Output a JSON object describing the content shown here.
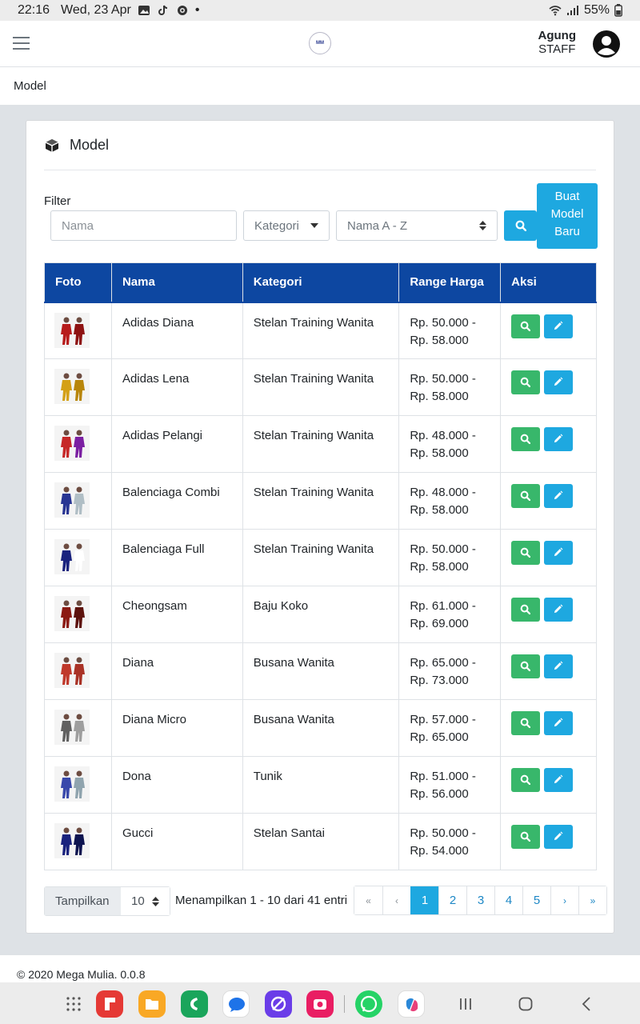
{
  "status_bar": {
    "time": "22:16",
    "date": "Wed, 23 Apr",
    "dot": "•",
    "battery": "55%"
  },
  "header": {
    "logo_text": "MM",
    "user_name": "Agung",
    "user_role": "STAFF"
  },
  "breadcrumb": "Model",
  "card": {
    "title": "Model"
  },
  "filter": {
    "label": "Filter",
    "nama_placeholder": "Nama",
    "kategori_value": "Kategori",
    "sort_value": "Nama A - Z",
    "buat_label": [
      "Buat",
      "Model",
      "Baru"
    ]
  },
  "table": {
    "columns": [
      "Foto",
      "Nama",
      "Kategori",
      "Range Harga",
      "Aksi"
    ],
    "rows": [
      {
        "nama": "Adidas Diana",
        "kategori": "Stelan Training Wanita",
        "harga_min": "Rp. 50.000 -",
        "harga_max": "Rp. 58.000"
      },
      {
        "nama": "Adidas Lena",
        "kategori": "Stelan Training Wanita",
        "harga_min": "Rp. 50.000 -",
        "harga_max": "Rp. 58.000"
      },
      {
        "nama": "Adidas Pelangi",
        "kategori": "Stelan Training Wanita",
        "harga_min": "Rp. 48.000 -",
        "harga_max": "Rp. 58.000"
      },
      {
        "nama": "Balenciaga Combi",
        "kategori": "Stelan Training Wanita",
        "harga_min": "Rp. 48.000 -",
        "harga_max": "Rp. 58.000"
      },
      {
        "nama": "Balenciaga Full",
        "kategori": "Stelan Training Wanita",
        "harga_min": "Rp. 50.000 -",
        "harga_max": "Rp. 58.000"
      },
      {
        "nama": "Cheongsam",
        "kategori": "Baju Koko",
        "harga_min": "Rp. 61.000 -",
        "harga_max": "Rp. 69.000"
      },
      {
        "nama": "Diana",
        "kategori": "Busana Wanita",
        "harga_min": "Rp. 65.000 -",
        "harga_max": "Rp. 73.000"
      },
      {
        "nama": "Diana Micro",
        "kategori": "Busana Wanita",
        "harga_min": "Rp. 57.000 -",
        "harga_max": "Rp. 65.000"
      },
      {
        "nama": "Dona",
        "kategori": "Tunik",
        "harga_min": "Rp. 51.000 -",
        "harga_max": "Rp. 56.000"
      },
      {
        "nama": "Gucci",
        "kategori": "Stelan Santai",
        "harga_min": "Rp. 50.000 -",
        "harga_max": "Rp. 54.000"
      }
    ]
  },
  "footer_controls": {
    "length_label": "Tampilkan",
    "length_value": "10",
    "entries_info": "Menampilkan 1 - 10 dari 41 entri",
    "pager": {
      "first": "«",
      "prev": "‹",
      "pages": [
        "1",
        "2",
        "3",
        "4",
        "5"
      ],
      "next": "›",
      "last": "»",
      "active": "1"
    }
  },
  "page_footer": "© 2020 Mega Mulia. 0.0.8",
  "colors": {
    "primary_header": "#0d47a1",
    "info": "#1ea8e0",
    "success": "#38b76b"
  }
}
